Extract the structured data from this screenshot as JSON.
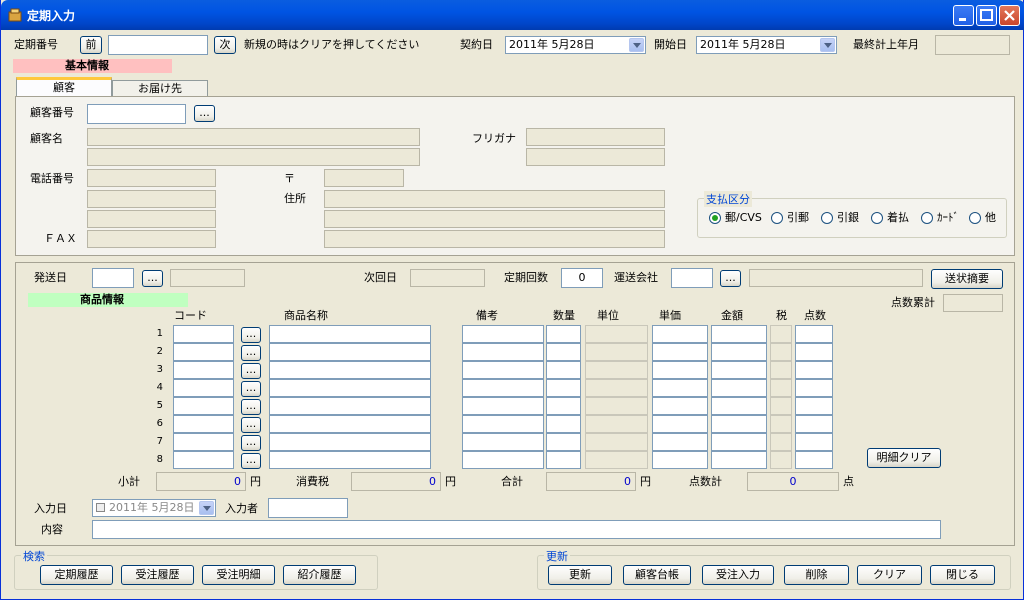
{
  "window": {
    "title": "定期入力"
  },
  "header": {
    "contract_no_label": "定期番号",
    "prev_label": "前",
    "next_label": "次",
    "new_hint": "新規の時はクリアを押してください",
    "contract_date_label": "契約日",
    "contract_date_value": "2011年  5月28日",
    "start_date_label": "開始日",
    "start_date_value": "2011年  5月28日",
    "last_month_label": "最終計上年月"
  },
  "basic_info": {
    "label": "基本情報"
  },
  "tabs": [
    {
      "label": "顧客"
    },
    {
      "label": "お届け先"
    }
  ],
  "customer": {
    "no_label": "顧客番号",
    "name_label": "顧客名",
    "furigana_label": "フリガナ",
    "phone_label": "電話番号",
    "zip_label": "〒",
    "address_label": "住所",
    "fax_label": "ＦＡＸ",
    "ellipsis": "..."
  },
  "payment": {
    "label": "支払区分",
    "options": [
      "郵/CVS",
      "引郵",
      "引銀",
      "着払",
      "ｶｰﾄﾞ",
      "他"
    ],
    "selected": "郵/CVS"
  },
  "shipping": {
    "send_date_label": "発送日",
    "next_date_label": "次回日",
    "times_label": "定期回数",
    "times_value": "0",
    "carrier_label": "運送会社",
    "slip_button": "送状摘要"
  },
  "product_info": {
    "label": "商品情報",
    "points_total_label": "点数累計"
  },
  "grid": {
    "columns": [
      "コード",
      "商品名称",
      "備考",
      "数量",
      "単位",
      "単価",
      "金額",
      "税",
      "点数"
    ],
    "rows": [
      "1",
      "2",
      "3",
      "4",
      "5",
      "6",
      "7",
      "8"
    ],
    "clear_button": "明細クリア"
  },
  "totals": {
    "subtotal_label": "小計",
    "subtotal_value": "0",
    "tax_label": "消費税",
    "tax_value": "0",
    "total_label": "合計",
    "total_value": "0",
    "points_label": "点数計",
    "points_value": "0",
    "yen": "円",
    "ten": "点"
  },
  "entry": {
    "date_label": "入力日",
    "date_value": "2011年  5月28日",
    "person_label": "入力者",
    "content_label": "内容"
  },
  "search": {
    "label": "検索",
    "buttons": [
      "定期履歴",
      "受注履歴",
      "受注明細",
      "紹介履歴"
    ]
  },
  "update": {
    "label": "更新",
    "buttons": [
      "更新",
      "顧客台帳",
      "受注入力",
      "削除",
      "クリア",
      "閉じる"
    ]
  }
}
